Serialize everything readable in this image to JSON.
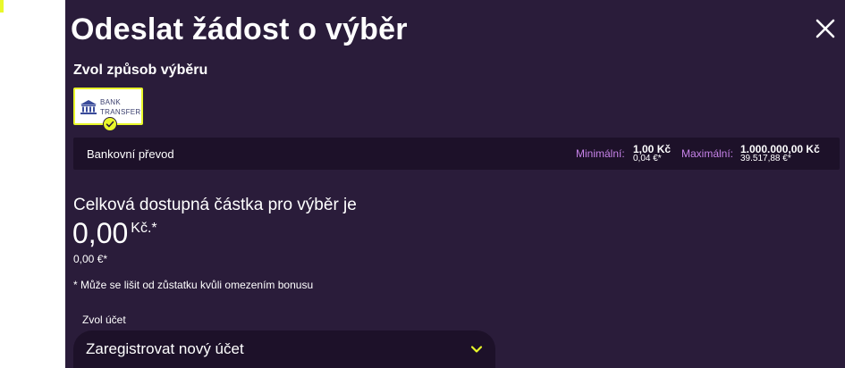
{
  "modal": {
    "title": "Odeslat žádost o výběr",
    "close_icon": "close-icon"
  },
  "method_section": {
    "label": "Zvol způsob výběru",
    "card": {
      "icon": "bank-icon",
      "line1": "BANK",
      "line2": "TRANSFER",
      "selected_icon": "check-icon"
    }
  },
  "method_info": {
    "name": "Bankovní převod",
    "min_label": "Minimální:",
    "min_value": "1,00 Kč",
    "min_sub": "0,04 €*",
    "max_label": "Maximální:",
    "max_value": "1.000.000,00 Kč",
    "max_sub": "39.517,88 €*"
  },
  "available": {
    "heading": "Celková dostupná částka pro výběr je",
    "amount": "0,00",
    "currency": "Kč.*",
    "eur": "0,00 €*",
    "disclaimer": "* Může se lišit od zůstatku kvůli omezením bonusu"
  },
  "account": {
    "label": "Zvol účet",
    "selected": "Zaregistrovat nový účet",
    "chevron_icon": "chevron-down-icon"
  },
  "colors": {
    "modal_bg": "#2a1c3a",
    "panel_bg": "#1d1129",
    "accent_yellow": "#e9f82a",
    "accent_pink": "#c783e9"
  }
}
